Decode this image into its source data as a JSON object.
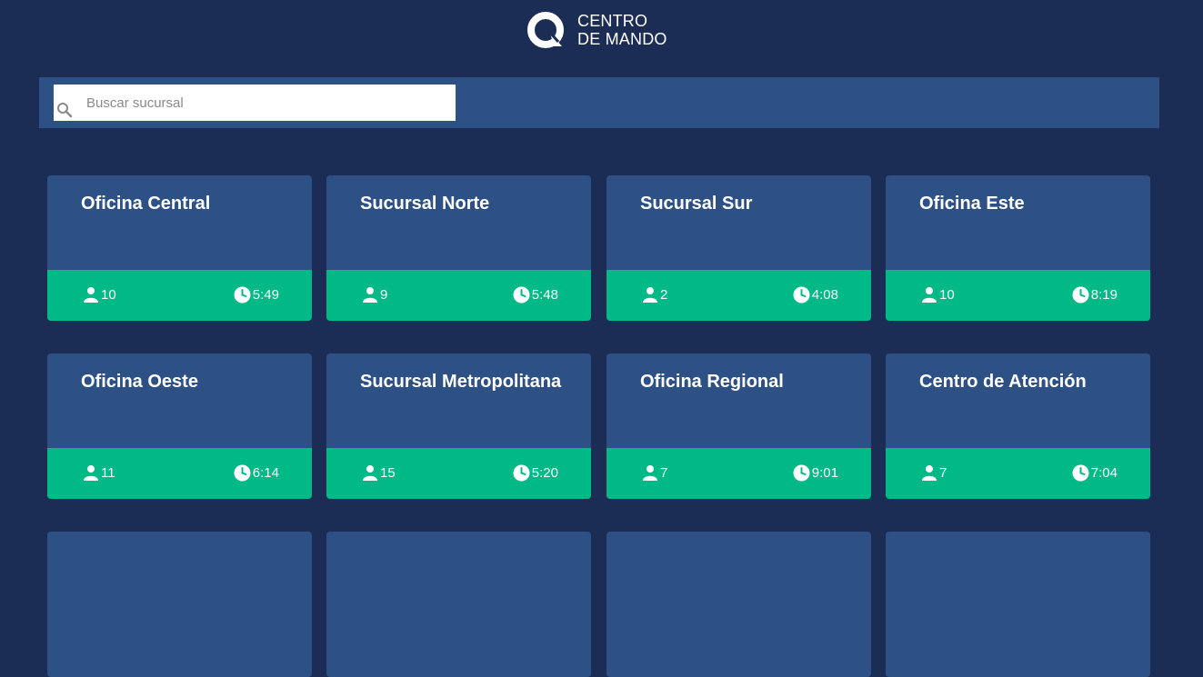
{
  "header": {
    "logo_line1": "CENTRO",
    "logo_line2": "DE MANDO"
  },
  "search": {
    "placeholder": "Buscar sucursal",
    "value": ""
  },
  "colors": {
    "background": "#1c2d55",
    "card": "#2d5185",
    "card_footer": "#00b986"
  },
  "cards": [
    {
      "title": "Oficina Central",
      "people": "10",
      "time": "5:49"
    },
    {
      "title": "Sucursal Norte",
      "people": "9",
      "time": "5:48"
    },
    {
      "title": "Sucursal Sur",
      "people": "2",
      "time": "4:08"
    },
    {
      "title": "Oficina Este",
      "people": "10",
      "time": "8:19"
    },
    {
      "title": "Oficina Oeste",
      "people": "11",
      "time": "6:14"
    },
    {
      "title": "Sucursal Metropolitana",
      "people": "15",
      "time": "5:20"
    },
    {
      "title": "Oficina Regional",
      "people": "7",
      "time": "9:01"
    },
    {
      "title": "Centro de Atención",
      "people": "7",
      "time": "7:04"
    }
  ]
}
